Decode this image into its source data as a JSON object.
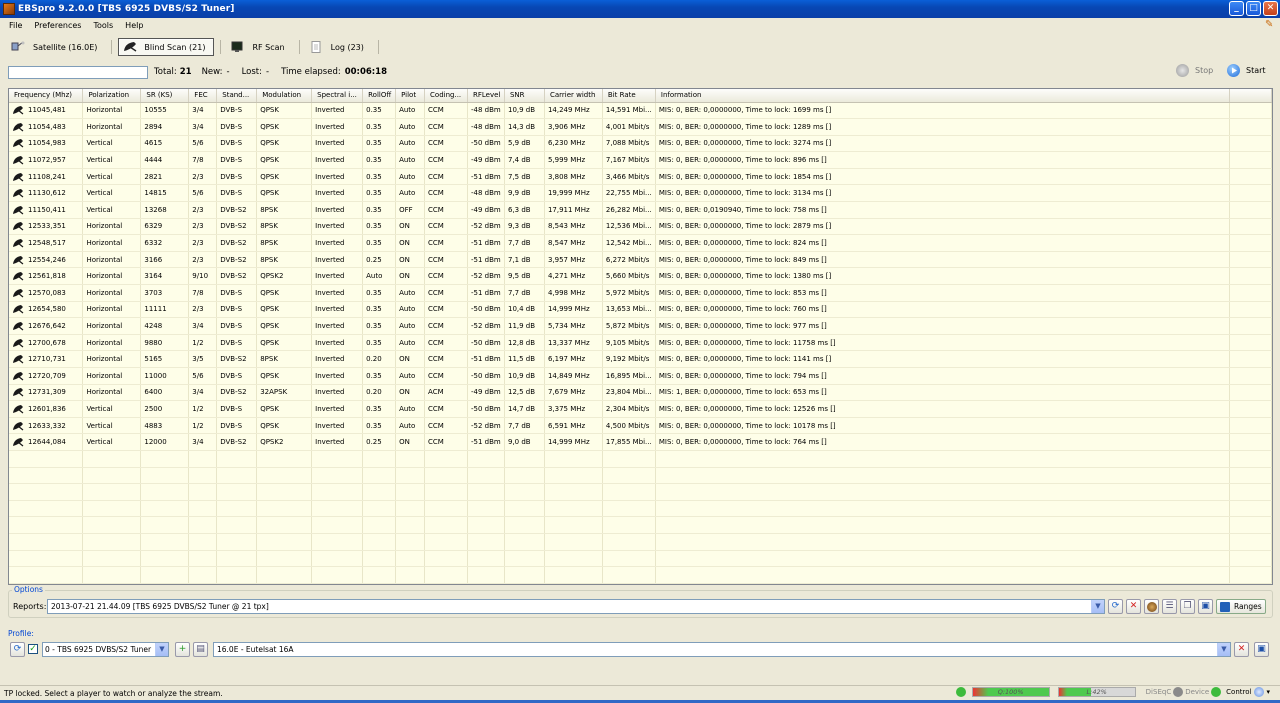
{
  "window": {
    "title": "EBSpro 9.2.0.0 [TBS 6925 DVBS/S2 Tuner]",
    "btn_min": "_",
    "btn_max": "□",
    "btn_close": "✕"
  },
  "menu": [
    "File",
    "Preferences",
    "Tools",
    "Help"
  ],
  "toolbar": [
    {
      "label": "Satellite (16.0E)",
      "icon": "satellite-icon"
    },
    {
      "label": "Blind Scan (21)",
      "icon": "dish-icon"
    },
    {
      "label": "RF Scan",
      "icon": "monitor-icon"
    },
    {
      "label": "Log (23)",
      "icon": "log-icon"
    }
  ],
  "status": {
    "total_label": "Total:",
    "total_value": "21",
    "new_label": "New:",
    "new_value": "-",
    "lost_label": "Lost:",
    "lost_value": "-",
    "elapsed_label": "Time elapsed:",
    "elapsed_value": "00:06:18"
  },
  "controls": {
    "stop": "Stop",
    "start": "Start"
  },
  "columns": [
    "Frequency (Mhz)",
    "Polarization",
    "SR (KS)",
    "FEC",
    "Stand...",
    "Modulation",
    "Spectral i...",
    "RollOff",
    "Pilot",
    "Coding...",
    "RFLevel",
    "SNR",
    "Carrier width",
    "Bit Rate",
    "Information"
  ],
  "rows": [
    [
      "11045,481",
      "Horizontal",
      "10555",
      "3/4",
      "DVB-S",
      "QPSK",
      "Inverted",
      "0.35",
      "Auto",
      "CCM",
      "-48 dBm",
      "10,9 dB",
      "14,249 MHz",
      "14,591 Mbi...",
      "MIS: 0, BER: 0,0000000, Time to lock: 1699 ms []"
    ],
    [
      "11054,483",
      "Horizontal",
      "2894",
      "3/4",
      "DVB-S",
      "QPSK",
      "Inverted",
      "0.35",
      "Auto",
      "CCM",
      "-48 dBm",
      "14,3 dB",
      "3,906 MHz",
      "4,001 Mbit/s",
      "MIS: 0, BER: 0,0000000, Time to lock: 1289 ms []"
    ],
    [
      "11054,983",
      "Vertical",
      "4615",
      "5/6",
      "DVB-S",
      "QPSK",
      "Inverted",
      "0.35",
      "Auto",
      "CCM",
      "-50 dBm",
      "5,9 dB",
      "6,230 MHz",
      "7,088 Mbit/s",
      "MIS: 0, BER: 0,0000000, Time to lock: 3274 ms []"
    ],
    [
      "11072,957",
      "Vertical",
      "4444",
      "7/8",
      "DVB-S",
      "QPSK",
      "Inverted",
      "0.35",
      "Auto",
      "CCM",
      "-49 dBm",
      "7,4 dB",
      "5,999 MHz",
      "7,167 Mbit/s",
      "MIS: 0, BER: 0,0000000, Time to lock: 896 ms []"
    ],
    [
      "11108,241",
      "Vertical",
      "2821",
      "2/3",
      "DVB-S",
      "QPSK",
      "Inverted",
      "0.35",
      "Auto",
      "CCM",
      "-51 dBm",
      "7,5 dB",
      "3,808 MHz",
      "3,466 Mbit/s",
      "MIS: 0, BER: 0,0000000, Time to lock: 1854 ms []"
    ],
    [
      "11130,612",
      "Vertical",
      "14815",
      "5/6",
      "DVB-S",
      "QPSK",
      "Inverted",
      "0.35",
      "Auto",
      "CCM",
      "-48 dBm",
      "9,9 dB",
      "19,999 MHz",
      "22,755 Mbi...",
      "MIS: 0, BER: 0,0000000, Time to lock: 3134 ms []"
    ],
    [
      "11150,411",
      "Vertical",
      "13268",
      "2/3",
      "DVB-S2",
      "8PSK",
      "Inverted",
      "0.35",
      "OFF",
      "CCM",
      "-49 dBm",
      "6,3 dB",
      "17,911 MHz",
      "26,282 Mbi...",
      "MIS: 0, BER: 0,0190940, Time to lock: 758 ms []"
    ],
    [
      "12533,351",
      "Horizontal",
      "6329",
      "2/3",
      "DVB-S2",
      "8PSK",
      "Inverted",
      "0.35",
      "ON",
      "CCM",
      "-52 dBm",
      "9,3 dB",
      "8,543 MHz",
      "12,536 Mbi...",
      "MIS: 0, BER: 0,0000000, Time to lock: 2879 ms []"
    ],
    [
      "12548,517",
      "Horizontal",
      "6332",
      "2/3",
      "DVB-S2",
      "8PSK",
      "Inverted",
      "0.35",
      "ON",
      "CCM",
      "-51 dBm",
      "7,7 dB",
      "8,547 MHz",
      "12,542 Mbi...",
      "MIS: 0, BER: 0,0000000, Time to lock: 824 ms []"
    ],
    [
      "12554,246",
      "Horizontal",
      "3166",
      "2/3",
      "DVB-S2",
      "8PSK",
      "Inverted",
      "0.25",
      "ON",
      "CCM",
      "-51 dBm",
      "7,1 dB",
      "3,957 MHz",
      "6,272 Mbit/s",
      "MIS: 0, BER: 0,0000000, Time to lock: 849 ms []"
    ],
    [
      "12561,818",
      "Horizontal",
      "3164",
      "9/10",
      "DVB-S2",
      "QPSK2",
      "Inverted",
      "Auto",
      "ON",
      "CCM",
      "-52 dBm",
      "9,5 dB",
      "4,271 MHz",
      "5,660 Mbit/s",
      "MIS: 0, BER: 0,0000000, Time to lock: 1380 ms []"
    ],
    [
      "12570,083",
      "Horizontal",
      "3703",
      "7/8",
      "DVB-S",
      "QPSK",
      "Inverted",
      "0.35",
      "Auto",
      "CCM",
      "-51 dBm",
      "7,7 dB",
      "4,998 MHz",
      "5,972 Mbit/s",
      "MIS: 0, BER: 0,0000000, Time to lock: 853 ms []"
    ],
    [
      "12654,580",
      "Horizontal",
      "11111",
      "2/3",
      "DVB-S",
      "QPSK",
      "Inverted",
      "0.35",
      "Auto",
      "CCM",
      "-50 dBm",
      "10,4 dB",
      "14,999 MHz",
      "13,653 Mbi...",
      "MIS: 0, BER: 0,0000000, Time to lock: 760 ms []"
    ],
    [
      "12676,642",
      "Horizontal",
      "4248",
      "3/4",
      "DVB-S",
      "QPSK",
      "Inverted",
      "0.35",
      "Auto",
      "CCM",
      "-52 dBm",
      "11,9 dB",
      "5,734 MHz",
      "5,872 Mbit/s",
      "MIS: 0, BER: 0,0000000, Time to lock: 977 ms []"
    ],
    [
      "12700,678",
      "Horizontal",
      "9880",
      "1/2",
      "DVB-S",
      "QPSK",
      "Inverted",
      "0.35",
      "Auto",
      "CCM",
      "-50 dBm",
      "12,8 dB",
      "13,337 MHz",
      "9,105 Mbit/s",
      "MIS: 0, BER: 0,0000000, Time to lock: 11758 ms []"
    ],
    [
      "12710,731",
      "Horizontal",
      "5165",
      "3/5",
      "DVB-S2",
      "8PSK",
      "Inverted",
      "0.20",
      "ON",
      "CCM",
      "-51 dBm",
      "11,5 dB",
      "6,197 MHz",
      "9,192 Mbit/s",
      "MIS: 0, BER: 0,0000000, Time to lock: 1141 ms []"
    ],
    [
      "12720,709",
      "Horizontal",
      "11000",
      "5/6",
      "DVB-S",
      "QPSK",
      "Inverted",
      "0.35",
      "Auto",
      "CCM",
      "-50 dBm",
      "10,9 dB",
      "14,849 MHz",
      "16,895 Mbi...",
      "MIS: 0, BER: 0,0000000, Time to lock: 794 ms []"
    ],
    [
      "12731,309",
      "Horizontal",
      "6400",
      "3/4",
      "DVB-S2",
      "32APSK",
      "Inverted",
      "0.20",
      "ON",
      "ACM",
      "-49 dBm",
      "12,5 dB",
      "7,679 MHz",
      "23,804 Mbi...",
      "MIS: 1, BER: 0,0000000, Time to lock: 653 ms []"
    ],
    [
      "12601,836",
      "Vertical",
      "2500",
      "1/2",
      "DVB-S",
      "QPSK",
      "Inverted",
      "0.35",
      "Auto",
      "CCM",
      "-50 dBm",
      "14,7 dB",
      "3,375 MHz",
      "2,304 Mbit/s",
      "MIS: 0, BER: 0,0000000, Time to lock: 12526 ms []"
    ],
    [
      "12633,332",
      "Vertical",
      "4883",
      "1/2",
      "DVB-S",
      "QPSK",
      "Inverted",
      "0.35",
      "Auto",
      "CCM",
      "-52 dBm",
      "7,7 dB",
      "6,591 MHz",
      "4,500 Mbit/s",
      "MIS: 0, BER: 0,0000000, Time to lock: 10178 ms []"
    ],
    [
      "12644,084",
      "Vertical",
      "12000",
      "3/4",
      "DVB-S2",
      "QPSK2",
      "Inverted",
      "0.25",
      "ON",
      "CCM",
      "-51 dBm",
      "9,0 dB",
      "14,999 MHz",
      "17,855 Mbi...",
      "MIS: 0, BER: 0,0000000, Time to lock: 764 ms []"
    ]
  ],
  "options": {
    "title": "Options",
    "reports_label": "Reports:",
    "reports_value": "2013-07-21 21.44.09 [TBS 6925 DVBS/S2 Tuner @ 21 tpx]",
    "ranges_label": "Ranges"
  },
  "profile": {
    "title": "Profile:",
    "tuner_value": "0 - TBS 6925 DVBS/S2 Tuner",
    "satellite_value": "16.0E - Eutelsat 16A",
    "checked": true
  },
  "statusbar": {
    "message": "TP locked. Select a player to watch or analyze the stream.",
    "quality_label": "Q:100%",
    "quality_value": 100,
    "level_label": "L:42%",
    "level_value": 42,
    "disecq_label": "DiSEqC",
    "device_label": "Device",
    "control_label": "Control"
  },
  "colors": {
    "accent": "#0046d5",
    "grid_bg": "#fefee8",
    "quality_fill": "#4fc94f",
    "led_green": "#3dbb3d"
  }
}
